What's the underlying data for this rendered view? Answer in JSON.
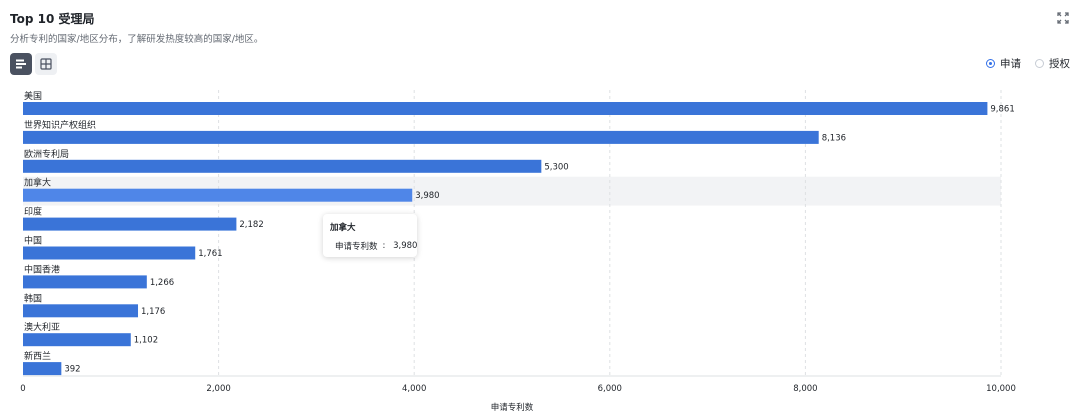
{
  "header": {
    "title": "Top 10 受理局",
    "subtitle": "分析专利的国家/地区分布，了解研发热度较高的国家/地区。"
  },
  "radios": [
    {
      "label": "申请",
      "checked": true
    },
    {
      "label": "授权",
      "checked": false
    }
  ],
  "tooltip": {
    "title": "加拿大",
    "series_label": "申请专利数",
    "value": "3,980"
  },
  "chart_data": {
    "type": "bar",
    "orientation": "horizontal",
    "categories": [
      "美国",
      "世界知识产权组织",
      "欧洲专利局",
      "加拿大",
      "印度",
      "中国",
      "中国香港",
      "韩国",
      "澳大利亚",
      "新西兰"
    ],
    "values": [
      9861,
      8136,
      5300,
      3980,
      2182,
      1761,
      1266,
      1176,
      1102,
      392
    ],
    "value_labels": [
      "9,861",
      "8,136",
      "5,300",
      "3,980",
      "2,182",
      "1,761",
      "1,266",
      "1,176",
      "1,102",
      "392"
    ],
    "xlabel": "申请专利数",
    "xlim": [
      0,
      10000
    ],
    "xticks": [
      0,
      2000,
      4000,
      6000,
      8000,
      10000
    ],
    "xtick_labels": [
      "0",
      "2,000",
      "4,000",
      "6,000",
      "8,000",
      "10,000"
    ],
    "grid": "vertical dashed",
    "highlighted_category": "加拿大",
    "bar_color": "#3a74d8",
    "highlight_bar_color": "#4f86e8"
  }
}
